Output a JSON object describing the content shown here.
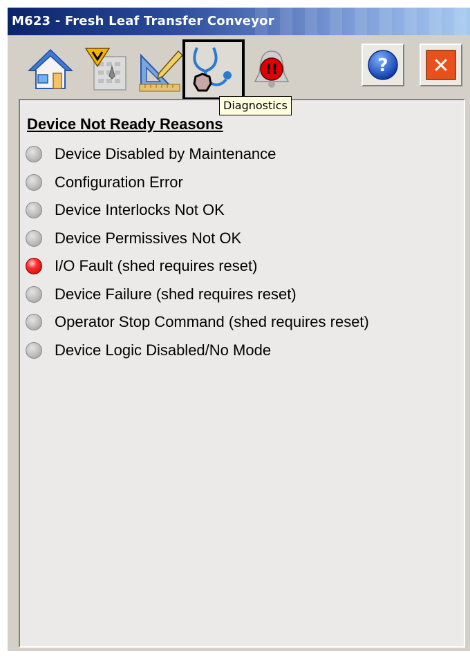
{
  "window": {
    "title": "M623 - Fresh Leaf Transfer Conveyor"
  },
  "toolbar": {
    "tabs": [
      {
        "icon": "home-icon"
      },
      {
        "icon": "maintenance-icon"
      },
      {
        "icon": "engineering-icon"
      },
      {
        "icon": "diagnostics-stethoscope-icon",
        "selected": true
      },
      {
        "icon": "alarm-bell-icon"
      }
    ],
    "help_label": "?",
    "close_label": "✕",
    "alarm_badge": "!!",
    "tooltip": "Diagnostics"
  },
  "diagnostics": {
    "heading": "Device Not Ready Reasons",
    "reasons": [
      {
        "label": "Device Disabled by Maintenance",
        "active": false
      },
      {
        "label": "Configuration Error",
        "active": false
      },
      {
        "label": "Device Interlocks Not OK",
        "active": false
      },
      {
        "label": "Device Permissives Not OK",
        "active": false
      },
      {
        "label": "I/O Fault (shed requires reset)",
        "active": true
      },
      {
        "label": "Device Failure (shed requires reset)",
        "active": false
      },
      {
        "label": "Operator Stop Command (shed requires reset)",
        "active": false
      },
      {
        "label": "Device Logic Disabled/No Mode",
        "active": false
      }
    ]
  },
  "colors": {
    "title_bar": "#0a246a",
    "active_indicator": "#ff2020",
    "inactive_indicator": "#bdbdbd",
    "close_button": "#e8501c",
    "help_button": "#1e5bd6"
  }
}
